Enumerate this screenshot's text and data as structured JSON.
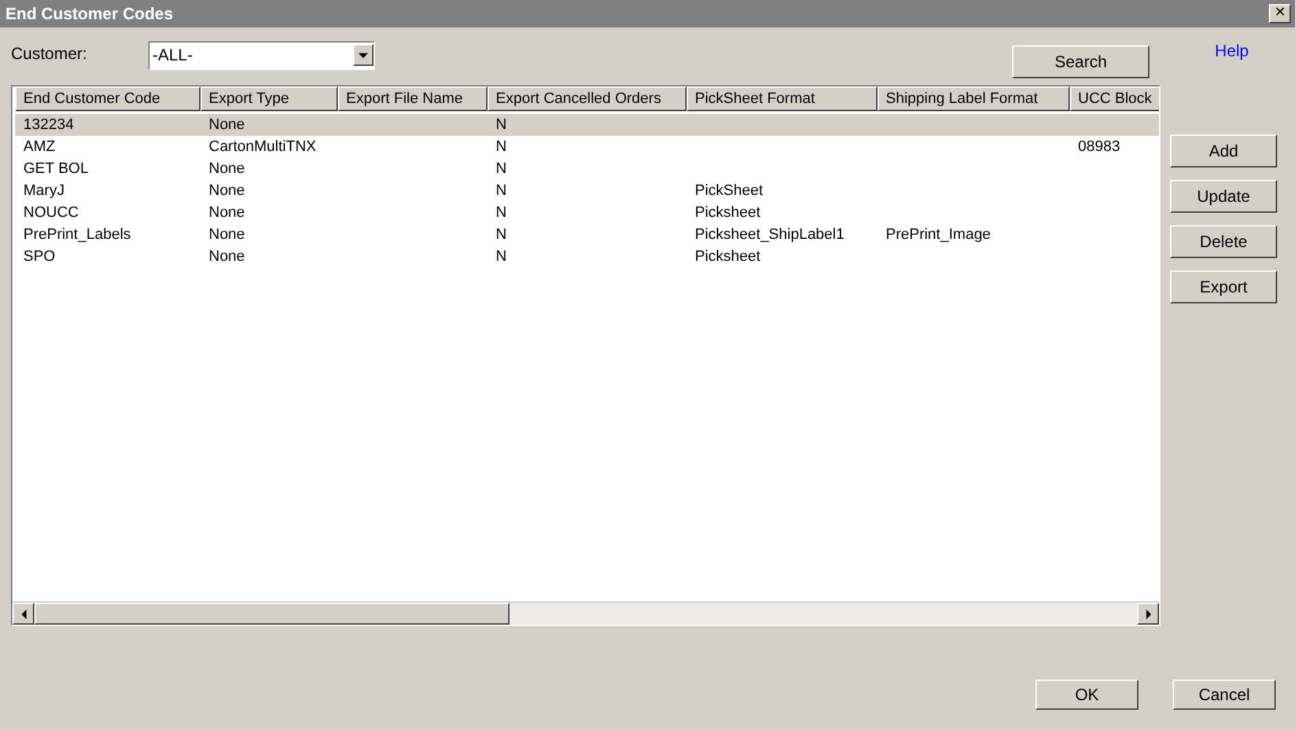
{
  "window": {
    "title": "End Customer Codes",
    "close": "✕"
  },
  "help": "Help",
  "customer": {
    "label": "Customer:",
    "value": "-ALL-"
  },
  "search_button": "Search",
  "table": {
    "columns": [
      "End Customer Code",
      "Export Type",
      "Export File Name",
      "Export Cancelled Orders",
      "PickSheet Format",
      "Shipping Label Format",
      "UCC Block"
    ],
    "rows": [
      {
        "selected": true,
        "cells": [
          "132234",
          "None",
          null,
          "N",
          null,
          null,
          null
        ]
      },
      {
        "selected": false,
        "cells": [
          "AMZ",
          "CartonMultiTNX",
          null,
          "N",
          null,
          null,
          "08983"
        ]
      },
      {
        "selected": false,
        "cells": [
          "GET BOL",
          "None",
          null,
          "N",
          null,
          null,
          null
        ]
      },
      {
        "selected": false,
        "cells": [
          "MaryJ",
          "None",
          null,
          "N",
          "PickSheet",
          null,
          null
        ]
      },
      {
        "selected": false,
        "cells": [
          "NOUCC",
          "None",
          null,
          "N",
          "Picksheet",
          null,
          null
        ]
      },
      {
        "selected": false,
        "cells": [
          "PrePrint_Labels",
          "None",
          null,
          "N",
          "Picksheet_ShipLabel1",
          "PrePrint_Image",
          null
        ]
      },
      {
        "selected": false,
        "cells": [
          "SPO",
          "None",
          null,
          "N",
          "Picksheet",
          null,
          null
        ]
      }
    ]
  },
  "side_buttons": [
    "Add",
    "Update",
    "Delete",
    "Export"
  ],
  "footer_buttons": [
    "OK",
    "Cancel"
  ]
}
